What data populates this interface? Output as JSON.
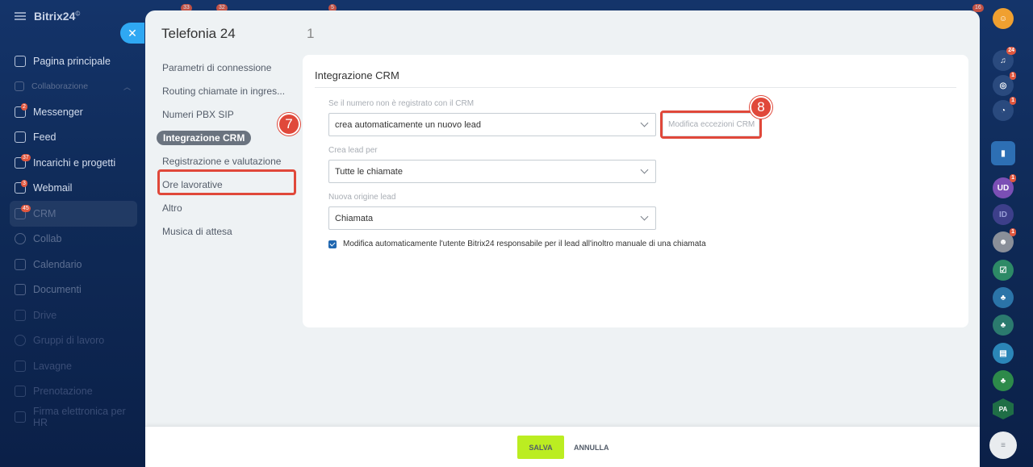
{
  "app": {
    "logo": "Bitrix24",
    "logo_mark": "©"
  },
  "sidebar": {
    "items": [
      {
        "label": "Pagina principale",
        "style": "normal"
      },
      {
        "label": "Collaborazione",
        "style": "section"
      },
      {
        "label": "Messenger",
        "style": "normal",
        "badge": "2"
      },
      {
        "label": "Feed",
        "style": "normal"
      },
      {
        "label": "Incarichi e progetti",
        "style": "normal",
        "badge": "37"
      },
      {
        "label": "Webmail",
        "style": "normal",
        "badge": "3"
      },
      {
        "label": "CRM",
        "style": "active",
        "badge": "45"
      },
      {
        "label": "Collab",
        "style": "dim"
      },
      {
        "label": "Calendario",
        "style": "dim"
      },
      {
        "label": "Documenti",
        "style": "dim"
      },
      {
        "label": "Drive",
        "style": "faint"
      },
      {
        "label": "Gruppi di lavoro",
        "style": "faint"
      },
      {
        "label": "Lavagne",
        "style": "faint"
      },
      {
        "label": "Prenotazione",
        "style": "faint"
      },
      {
        "label": "Firma elettronica per HR",
        "style": "faint"
      }
    ]
  },
  "top_counters": [
    "33",
    "32",
    "5",
    "16"
  ],
  "rail": {
    "notifications_badge": "24",
    "badge_one": "1",
    "avatar_ud": "UD",
    "avatar_id": "ID",
    "avatar_pa": "PA"
  },
  "panel": {
    "title": "Telefonia 24",
    "number": "1",
    "menu": [
      "Parametri di connessione",
      "Routing chiamate in ingres...",
      "Numeri PBX SIP",
      "Integrazione CRM",
      "Registrazione e valutazione",
      "Ore lavorative",
      "Altro",
      "Musica di attesa"
    ],
    "active_index": 3
  },
  "content": {
    "section_title": "Integrazione CRM",
    "field1": {
      "label": "Se il numero non è registrato con il CRM",
      "value": "crea automaticamente un nuovo lead"
    },
    "exceptions_button": "Modifica eccezioni CRM",
    "field2": {
      "label": "Crea lead per",
      "value": "Tutte le chiamate"
    },
    "field3": {
      "label": "Nuova origine lead",
      "value": "Chiamata"
    },
    "checkbox": {
      "checked": true,
      "label": "Modifica automaticamente l'utente Bitrix24 responsabile per il lead all'inoltro manuale di una chiamata"
    }
  },
  "steps": {
    "step7": "7",
    "step8": "8"
  },
  "footer": {
    "save": "SALVA",
    "cancel": "ANNULLA"
  },
  "colors": {
    "highlight": "#e0483a",
    "save_button": "#bbed21",
    "accent_blue": "#2fa8f3"
  }
}
